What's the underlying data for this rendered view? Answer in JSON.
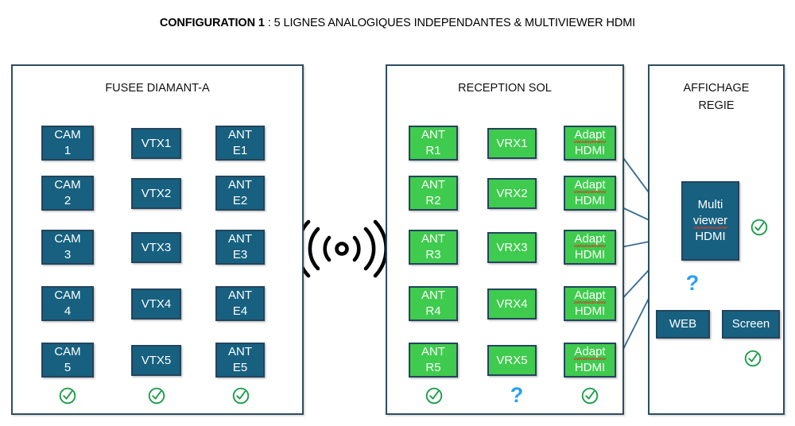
{
  "title": {
    "bold": "CONFIGURATION 1",
    "rest": " : 5 LIGNES ANALOGIQUES INDEPENDANTES & MULTIVIEWER HDMI"
  },
  "colors": {
    "teal_box": "#17607f",
    "green_box": "#3fcb4e",
    "panel_border": "#2d4d61",
    "arrow": "#3d7093",
    "check_green": "#1C9E4B",
    "question_blue": "#2AA0F2",
    "spellcheck_red": "#d23b2a"
  },
  "panels": [
    {
      "id": "fusee",
      "title": "FUSEE DIAMANT-A",
      "columns": [
        {
          "id": "cam",
          "nodes": [
            {
              "l1": "CAM",
              "l2": "1"
            },
            {
              "l1": "CAM",
              "l2": "2"
            },
            {
              "l1": "CAM",
              "l2": "3"
            },
            {
              "l1": "CAM",
              "l2": "4"
            },
            {
              "l1": "CAM",
              "l2": "5"
            }
          ],
          "status": "check"
        },
        {
          "id": "vtx",
          "nodes": [
            {
              "l1": "VTX1"
            },
            {
              "l1": "VTX2"
            },
            {
              "l1": "VTX3"
            },
            {
              "l1": "VTX4"
            },
            {
              "l1": "VTX5"
            }
          ],
          "status": "check"
        },
        {
          "id": "ante",
          "nodes": [
            {
              "l1": "ANT",
              "l2": "E1"
            },
            {
              "l1": "ANT",
              "l2": "E2"
            },
            {
              "l1": "ANT",
              "l2": "E3"
            },
            {
              "l1": "ANT",
              "l2": "E4"
            },
            {
              "l1": "ANT",
              "l2": "E5"
            }
          ],
          "status": "check"
        }
      ]
    },
    {
      "id": "reception",
      "title": "RECEPTION SOL",
      "columns": [
        {
          "id": "antr",
          "nodes": [
            {
              "l1": "ANT",
              "l2": "R1"
            },
            {
              "l1": "ANT",
              "l2": "R2"
            },
            {
              "l1": "ANT",
              "l2": "R3"
            },
            {
              "l1": "ANT",
              "l2": "R4"
            },
            {
              "l1": "ANT",
              "l2": "R5"
            }
          ],
          "status": "check"
        },
        {
          "id": "vrx",
          "nodes": [
            {
              "l1": "VRX1"
            },
            {
              "l1": "VRX2"
            },
            {
              "l1": "VRX3"
            },
            {
              "l1": "VRX4"
            },
            {
              "l1": "VRX5"
            }
          ],
          "status": "question"
        },
        {
          "id": "adapt",
          "nodes": [
            {
              "l1": "Adapt",
              "l2": "HDMI"
            },
            {
              "l1": "Adapt",
              "l2": "HDMI"
            },
            {
              "l1": "Adapt",
              "l2": "HDMI"
            },
            {
              "l1": "Adapt",
              "l2": "HDMI"
            },
            {
              "l1": "Adapt",
              "l2": "HDMI"
            }
          ],
          "status": "check"
        }
      ]
    },
    {
      "id": "affichage",
      "title_l1": "AFFICHAGE",
      "title_l2": "REGIE",
      "nodes": {
        "multiviewer": {
          "l1": "Multi",
          "l2": "viewer",
          "l3": "HDMI"
        },
        "web": {
          "l1": "WEB"
        },
        "screen": {
          "l1": "Screen"
        }
      },
      "status": {
        "multiviewer": "check",
        "web": "question",
        "screen": "check"
      }
    }
  ],
  "symbols": {
    "rf_link": "wireless-signal",
    "check": "check-circle",
    "question": "?"
  }
}
